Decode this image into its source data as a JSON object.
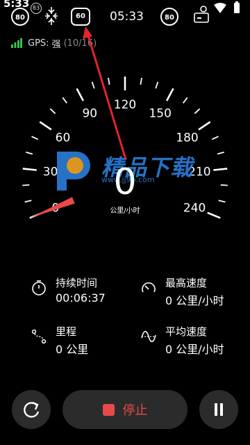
{
  "status_bar": {
    "time_left": "5:33",
    "badge": "83",
    "speed_limit_left": "80",
    "speed_limit_mid": "60",
    "clock": "05:33",
    "speed_limit_right": "80"
  },
  "gps": {
    "label": "GPS:",
    "strength": "强",
    "satellites": "(10/16)"
  },
  "gauge": {
    "ticks": [
      "0",
      "30",
      "60",
      "90",
      "120",
      "150",
      "180",
      "210",
      "240"
    ],
    "min": 0,
    "max": 240,
    "current_speed": "0",
    "unit": "公里/小时"
  },
  "watermark": {
    "text": "精品下载",
    "url": "www.jj9p.com"
  },
  "stats": {
    "duration": {
      "label": "持续时间",
      "value": "00:06:37"
    },
    "max_speed": {
      "label": "最高速度",
      "value": "0 公里/小时"
    },
    "distance": {
      "label": "里程",
      "value": "0 公里"
    },
    "avg_speed": {
      "label": "平均速度",
      "value": "0 公里/小时"
    }
  },
  "controls": {
    "stop_label": "停止"
  },
  "colors": {
    "accent_red": "#e84a4a",
    "gps_green": "#3ec14a",
    "button_bg": "#2b2b2b",
    "watermark_blue": "#2a7fdc",
    "watermark_orange": "#f5a623"
  }
}
